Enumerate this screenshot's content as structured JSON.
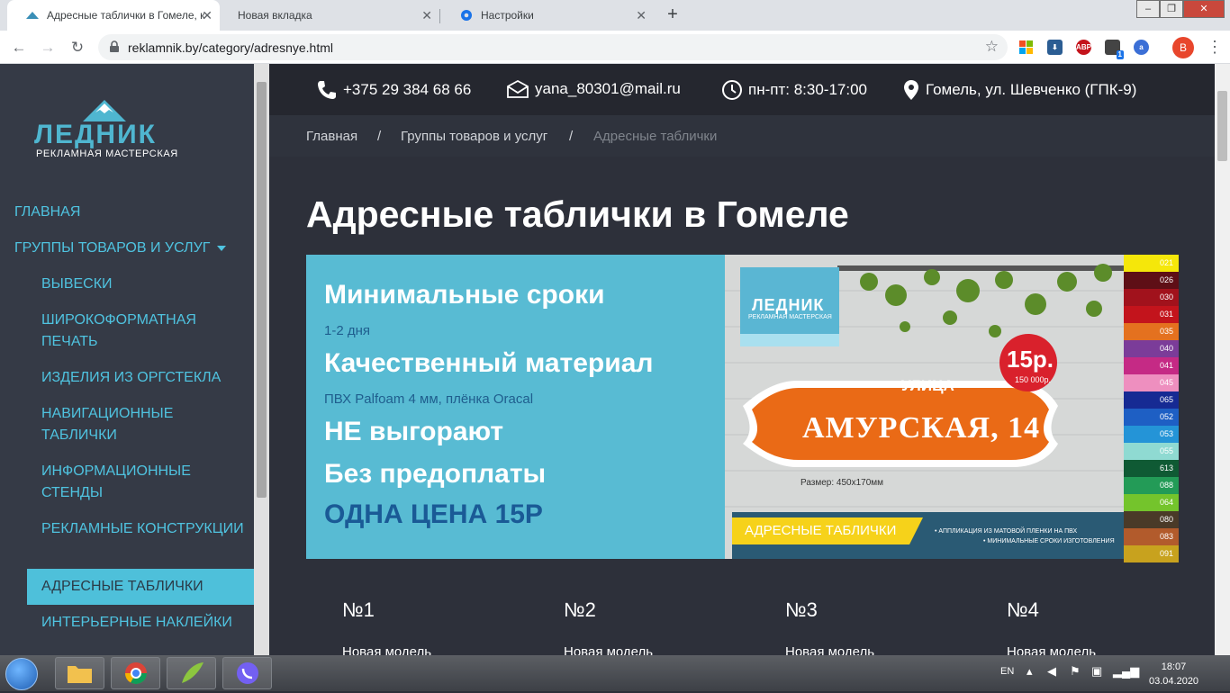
{
  "browser": {
    "tabs": [
      {
        "title": "Адресные таблички в Гомеле, к",
        "active": true
      },
      {
        "title": "Новая вкладка",
        "active": false
      },
      {
        "title": "Настройки",
        "active": false
      }
    ],
    "url": "reklamnik.by/category/adresnye.html",
    "profile_initial": "В",
    "extensions": [
      "windows-icon",
      "download-icon",
      "abp-icon",
      "extension-icon",
      "a-icon"
    ],
    "extension_labels": {
      "abp": "ABP",
      "badge": "1",
      "a": "a"
    }
  },
  "sidebar": {
    "logo": {
      "brand": "ЛЕДНИК",
      "subtitle": "РЕКЛАМНАЯ МАСТЕРСКАЯ"
    },
    "items": [
      {
        "label": "ГЛАВНАЯ"
      },
      {
        "label": "ГРУППЫ ТОВАРОВ И УСЛУГ"
      },
      {
        "label": "ВЫВЕСКИ"
      },
      {
        "label": "ШИРОКОФОРМАТНАЯ ПЕЧАТЬ"
      },
      {
        "label": "ИЗДЕЛИЯ ИЗ ОРГСТЕКЛА"
      },
      {
        "label": "НАВИГАЦИОННЫЕ ТАБЛИЧКИ"
      },
      {
        "label": "ИНФОРМАЦИОННЫЕ СТЕНДЫ"
      },
      {
        "label": "РЕКЛАМНЫЕ КОНСТРУКЦИИ"
      },
      {
        "label": "АДРЕСНЫЕ ТАБЛИЧКИ"
      },
      {
        "label": "ИНТЕРЬЕРНЫЕ НАКЛЕЙКИ"
      }
    ]
  },
  "contacts": {
    "phone": "+375 29 384 68 66",
    "email": "yana_80301@mail.ru",
    "hours": "пн-пт: 8:30-17:00",
    "address": "Гомель, ул. Шевченко (ГПК-9)"
  },
  "breadcrumb": {
    "home": "Главная",
    "groups": "Группы товаров и услуг",
    "current": "Адресные таблички",
    "sep": "/"
  },
  "page": {
    "title": "Адресные таблички в Гомеле"
  },
  "banner": {
    "h1": "Минимальные сроки",
    "s1": "1-2 дня",
    "h2": "Качественный материал",
    "s2": "ПВХ Palfoam 4 мм, плёнка Oracal",
    "h3": "НЕ выгорают",
    "h4": "Без предоплаты",
    "price": "ОДНА ЦЕНА 15Р",
    "image": {
      "logo_text": "ЛЕДНИК",
      "logo_sub": "РЕКЛАМНАЯ МАСТЕРСКАЯ",
      "price_badge": "15р.",
      "price_badge_old": "150 000р.",
      "street_label": "УЛИЦА",
      "street_name": "АМУРСКАЯ, 14",
      "size_text": "Размер: 450x170мм",
      "ribbon": "АДРЕСНЫЕ ТАБЛИЧКИ",
      "bullet1": "• АППЛИКАЦИЯ ИЗ МАТОВОЙ ПЛЕНКИ НА ПВХ",
      "bullet2": "• МИНИМАЛЬНЫЕ СРОКИ ИЗГОТОВЛЕНИЯ"
    },
    "swatches": [
      {
        "code": "021",
        "color": "#f5e70a"
      },
      {
        "code": "026",
        "color": "#5e0f16"
      },
      {
        "code": "030",
        "color": "#a1121c"
      },
      {
        "code": "031",
        "color": "#c3141c"
      },
      {
        "code": "035",
        "color": "#e4711f"
      },
      {
        "code": "040",
        "color": "#7b3c99"
      },
      {
        "code": "041",
        "color": "#c52a85"
      },
      {
        "code": "045",
        "color": "#ee8fbf"
      },
      {
        "code": "065",
        "color": "#162a93"
      },
      {
        "code": "052",
        "color": "#1e5fc4"
      },
      {
        "code": "053",
        "color": "#2494d7"
      },
      {
        "code": "055",
        "color": "#8fdad2"
      },
      {
        "code": "613",
        "color": "#0f5a34"
      },
      {
        "code": "088",
        "color": "#239b57"
      },
      {
        "code": "064",
        "color": "#74c42c"
      },
      {
        "code": "080",
        "color": "#4a3a28"
      },
      {
        "code": "083",
        "color": "#b25b2c"
      },
      {
        "code": "091",
        "color": "#c8a21e"
      }
    ]
  },
  "models": [
    {
      "number": "№1",
      "caption": "Новая модель"
    },
    {
      "number": "№2",
      "caption": "Новая модель"
    },
    {
      "number": "№3",
      "caption": "Новая модель"
    },
    {
      "number": "№4",
      "caption": "Новая модель"
    }
  ],
  "taskbar": {
    "lang": "EN",
    "time": "18:07",
    "date": "03.04.2020"
  }
}
